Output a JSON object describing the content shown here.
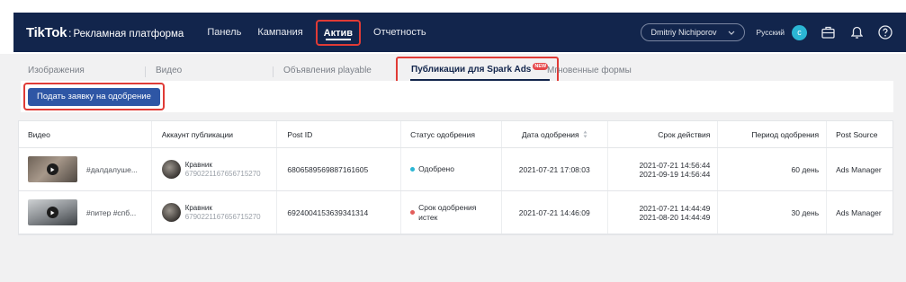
{
  "app": {
    "logo_main": "TikTok",
    "logo_sep": ":",
    "logo_sub": "Рекламная платформа"
  },
  "nav": {
    "items": [
      "Панель",
      "Кампания",
      "Актив",
      "Отчетность"
    ],
    "active_index": 2
  },
  "user": {
    "name": "Dmitriy Nichiporov",
    "language": "Русский",
    "avatar_letter": "c"
  },
  "tabs": {
    "items": [
      "Изображения",
      "Видео",
      "Объявления playable",
      "Публикации для Spark Ads",
      "Мгновенные формы"
    ],
    "new_badge": "NEW",
    "active_index": 3
  },
  "actions": {
    "submit_label": "Подать заявку на одобрение"
  },
  "table": {
    "headers": [
      "Видео",
      "Аккаунт публикации",
      "Post ID",
      "Статус одобрения",
      "Дата одобрения",
      "Срок действия",
      "Период одобрения",
      "Post Source"
    ],
    "rows": [
      {
        "video_title": "#далдалуше...",
        "account_name": "Кравник",
        "account_id": "6790221167656715270",
        "post_id": "6806589569887161605",
        "status": "Одобрено",
        "status_color": "#2bb6d4",
        "approval_date": "2021-07-21 17:08:03",
        "valid_from": "2021-07-21 14:56:44",
        "valid_to": "2021-09-19 14:56:44",
        "period": "60 день",
        "source": "Ads Manager"
      },
      {
        "video_title": "#питер #спб...",
        "account_name": "Кравник",
        "account_id": "6790221167656715270",
        "post_id": "6924004153639341314",
        "status": "Срок одобрения истек",
        "status_color": "#e35d5b",
        "approval_date": "2021-07-21 14:46:09",
        "valid_from": "2021-07-21 14:44:49",
        "valid_to": "2021-08-20 14:44:49",
        "period": "30 день",
        "source": "Ads Manager"
      }
    ]
  },
  "colors": {
    "navbar": "#12254c",
    "primary_button": "#2e56a5",
    "highlight": "#e03b36"
  }
}
